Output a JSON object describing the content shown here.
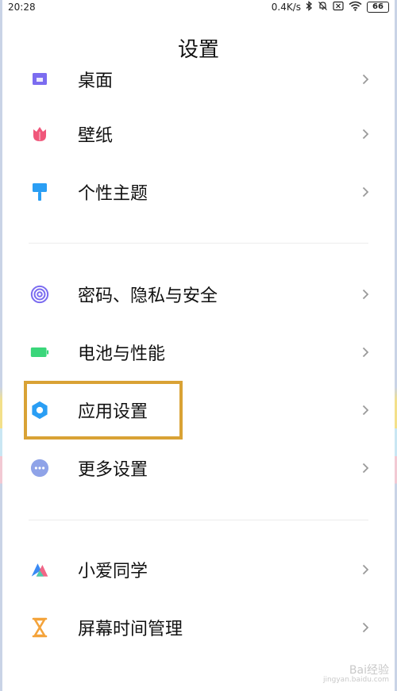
{
  "status": {
    "time": "20:28",
    "net_speed": "0.4K/s",
    "battery": "66",
    "icons": [
      "bluetooth-icon",
      "mute-icon",
      "sim-off-icon",
      "wifi-icon",
      "battery-icon"
    ]
  },
  "header": {
    "title": "设置"
  },
  "items": [
    {
      "label": "桌面",
      "icon": "desktop-icon",
      "color": "#7b6cf0"
    },
    {
      "label": "壁纸",
      "icon": "tulip-icon",
      "color": "#f0567a"
    },
    {
      "label": "个性主题",
      "icon": "brush-icon",
      "color": "#2a9ef4"
    },
    {
      "label": "密码、隐私与安全",
      "icon": "fingerprint-icon",
      "color": "#7b6cf0"
    },
    {
      "label": "电池与性能",
      "icon": "battery-icon",
      "color": "#3ad67a"
    },
    {
      "label": "应用设置",
      "icon": "gear-icon",
      "color": "#2a9ef4"
    },
    {
      "label": "更多设置",
      "icon": "more-icon",
      "color": "#8fa3e8"
    },
    {
      "label": "小爱同学",
      "icon": "xiaoai-icon",
      "color": "#3a8af4"
    },
    {
      "label": "屏幕时间管理",
      "icon": "hourglass-icon",
      "color": "#f4a33a"
    }
  ],
  "watermark": {
    "text": "Bai经验",
    "sub": "jingyan.baidu.com"
  }
}
